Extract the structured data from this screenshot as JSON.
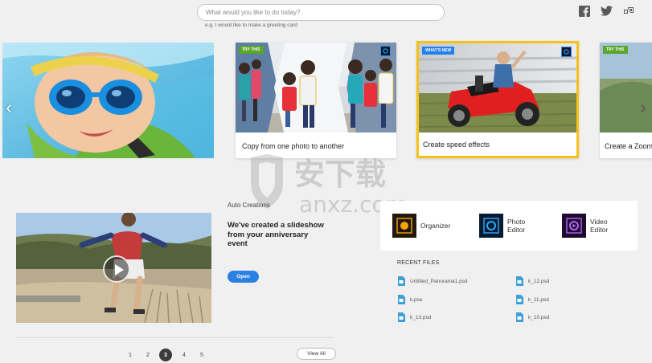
{
  "search": {
    "placeholder": "What would you like to do today?",
    "hint": "e.g. I would like to make a greeting card"
  },
  "social": {
    "icons": [
      "facebook-icon",
      "twitter-icon",
      "share-icon"
    ]
  },
  "carousel": {
    "cards": [
      {
        "badge": "",
        "caption": ""
      },
      {
        "badge": "TRY THIS",
        "caption": "Copy from one photo to another"
      },
      {
        "badge": "WHAT'S NEW",
        "caption": "Create speed effects"
      },
      {
        "badge": "TRY THIS",
        "caption": "Create a Zoom"
      }
    ],
    "highlight_color": "#f5c318"
  },
  "auto_creations": {
    "label": "Auto Creations",
    "headline": "We've created a slideshow from your anniversary event",
    "open_label": "Open",
    "pagination": [
      "1",
      "2",
      "3",
      "4",
      "5"
    ],
    "active_page": "3",
    "view_all_label": "View All"
  },
  "launcher": {
    "apps": [
      {
        "name": "Organizer",
        "icon": "organizer-icon",
        "color": "#f2a20c"
      },
      {
        "name": "Photo\nEditor",
        "icon": "photo-editor-icon",
        "color": "#31a8ff"
      },
      {
        "name": "Video\nEditor",
        "icon": "video-editor-icon",
        "color": "#b065f5"
      }
    ]
  },
  "recent_files": {
    "title": "RECENT FILES",
    "left": [
      "Untitled_Panorama1.psd",
      "k.pse",
      "k_13.psd"
    ],
    "right": [
      "k_12.psd",
      "k_11.psd",
      "k_10.psd"
    ]
  },
  "watermark": {
    "text": "安下载",
    "domain": "anxz.com"
  }
}
